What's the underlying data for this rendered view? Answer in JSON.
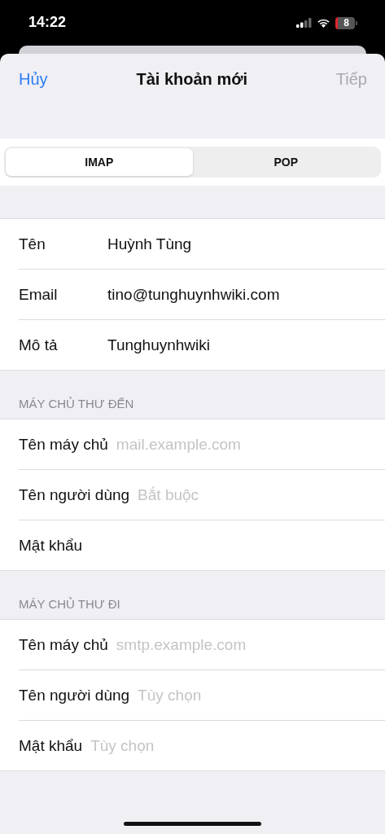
{
  "status_bar": {
    "time": "14:22",
    "battery": "8"
  },
  "nav": {
    "cancel": "Hủy",
    "title": "Tài khoản mới",
    "next": "Tiếp",
    "next_disabled": true
  },
  "segments": [
    {
      "label": "IMAP",
      "selected": true
    },
    {
      "label": "POP",
      "selected": false
    }
  ],
  "groups": [
    {
      "kind": "account",
      "rows": [
        {
          "label": "Tên",
          "value": "Huỳnh Tùng"
        },
        {
          "label": "Email",
          "value": "tino@tunghuynhwiki.com"
        },
        {
          "label": "Mô tả",
          "value": "Tunghuynhwiki"
        }
      ]
    },
    {
      "kind": "server",
      "header": "MÁY CHỦ THƯ ĐẾN",
      "rows": [
        {
          "label": "Tên máy chủ",
          "placeholder": "mail.example.com"
        },
        {
          "label": "Tên người dùng",
          "placeholder": "Bắt buộc"
        },
        {
          "label": "Mật khẩu"
        }
      ]
    },
    {
      "kind": "server",
      "header": "MÁY CHỦ THƯ ĐI",
      "rows": [
        {
          "label": "Tên máy chủ",
          "placeholder": "smtp.example.com"
        },
        {
          "label": "Tên người dùng",
          "placeholder": "Tùy chọn"
        },
        {
          "label": "Mật khẩu",
          "placeholder": "Tùy chọn"
        }
      ]
    }
  ]
}
